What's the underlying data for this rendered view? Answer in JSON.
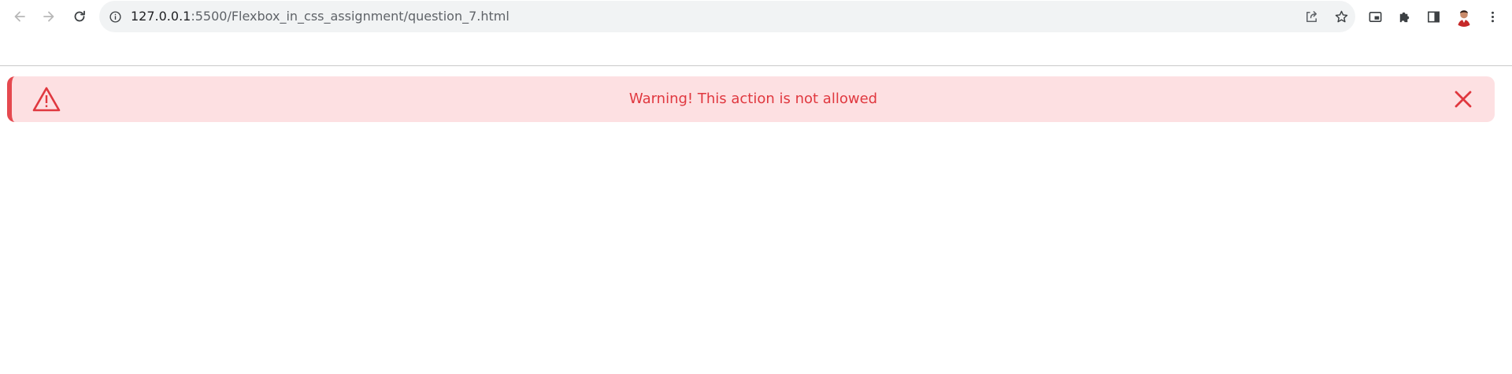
{
  "browser": {
    "url_host": "127.0.0.1",
    "url_path": ":5500/Flexbox_in_css_assignment/question_7.html",
    "nav": {
      "back_icon": "arrow-left-icon",
      "forward_icon": "arrow-right-icon",
      "reload_icon": "reload-icon"
    },
    "omnibox_icons": [
      "info-icon",
      "share-icon",
      "star-icon"
    ],
    "toolbar_icons": [
      "picture-in-picture-icon",
      "puzzle-icon",
      "side-panel-icon",
      "avatar",
      "kebab-menu-icon"
    ]
  },
  "alert": {
    "message": "Warning! This action is not allowed",
    "icon": "warning-icon",
    "close_icon": "close-icon",
    "colors": {
      "background": "#fde0e2",
      "accent": "#e5494f",
      "text": "#e0383f"
    }
  }
}
